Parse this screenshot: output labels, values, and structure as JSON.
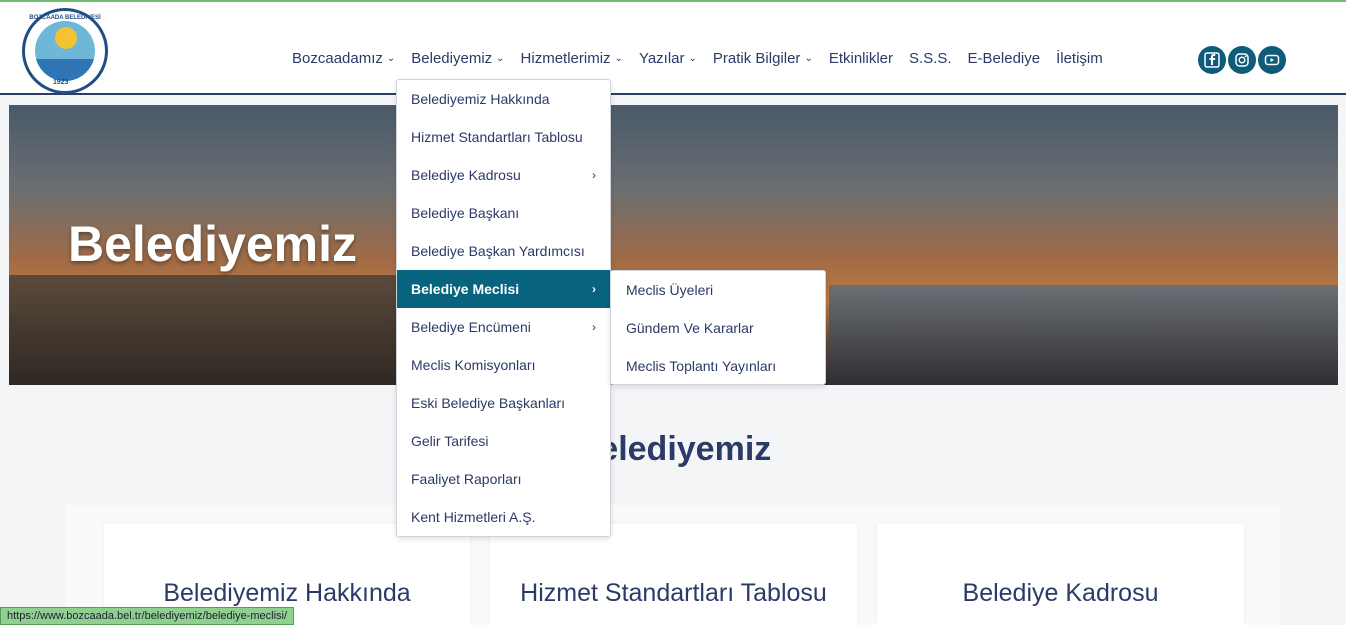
{
  "header": {
    "logo": {
      "ring_text": "BOZCAADA BELEDİYESİ",
      "year": "1923"
    },
    "nav": [
      {
        "label": "Bozcaadamız",
        "has_menu": true
      },
      {
        "label": "Belediyemiz",
        "has_menu": true
      },
      {
        "label": "Hizmetlerimiz",
        "has_menu": true
      },
      {
        "label": "Yazılar",
        "has_menu": true
      },
      {
        "label": "Pratik Bilgiler",
        "has_menu": true
      },
      {
        "label": "Etkinlikler",
        "has_menu": false
      },
      {
        "label": "S.S.S.",
        "has_menu": false
      },
      {
        "label": "E-Belediye",
        "has_menu": false
      },
      {
        "label": "İletişim",
        "has_menu": false
      }
    ],
    "social": [
      "facebook-icon",
      "instagram-icon",
      "youtube-icon"
    ]
  },
  "hero": {
    "title": "Belediyemiz"
  },
  "section": {
    "title": "Belediyemiz"
  },
  "cards": [
    "Belediyemiz Hakkında",
    "Hizmet Standartları Tablosu",
    "Belediye Kadrosu"
  ],
  "dropdown": {
    "items": [
      {
        "label": "Belediyemiz Hakkında"
      },
      {
        "label": "Hizmet Standartları Tablosu"
      },
      {
        "label": "Belediye Kadrosu",
        "arrow": "›"
      },
      {
        "label": "Belediye Başkanı"
      },
      {
        "label": "Belediye Başkan Yardımcısı"
      },
      {
        "label": "Belediye Meclisi",
        "arrow": "›",
        "active": true
      },
      {
        "label": "Belediye Encümeni",
        "arrow": "›"
      },
      {
        "label": "Meclis Komisyonları"
      },
      {
        "label": "Eski Belediye Başkanları"
      },
      {
        "label": "Gelir Tarifesi"
      },
      {
        "label": "Faaliyet Raporları"
      },
      {
        "label": "Kent Hizmetleri A.Ş."
      }
    ]
  },
  "submenu": {
    "items": [
      {
        "label": "Meclis Üyeleri"
      },
      {
        "label": "Gündem Ve Kararlar"
      },
      {
        "label": "Meclis Toplantı Yayınları"
      }
    ]
  },
  "status_bar": {
    "url": "https://www.bozcaada.bel.tr/belediyemiz/belediye-meclisi/"
  },
  "colors": {
    "primary": "#2b3a67",
    "accent": "#08637f",
    "status": "#8fcf8f"
  }
}
